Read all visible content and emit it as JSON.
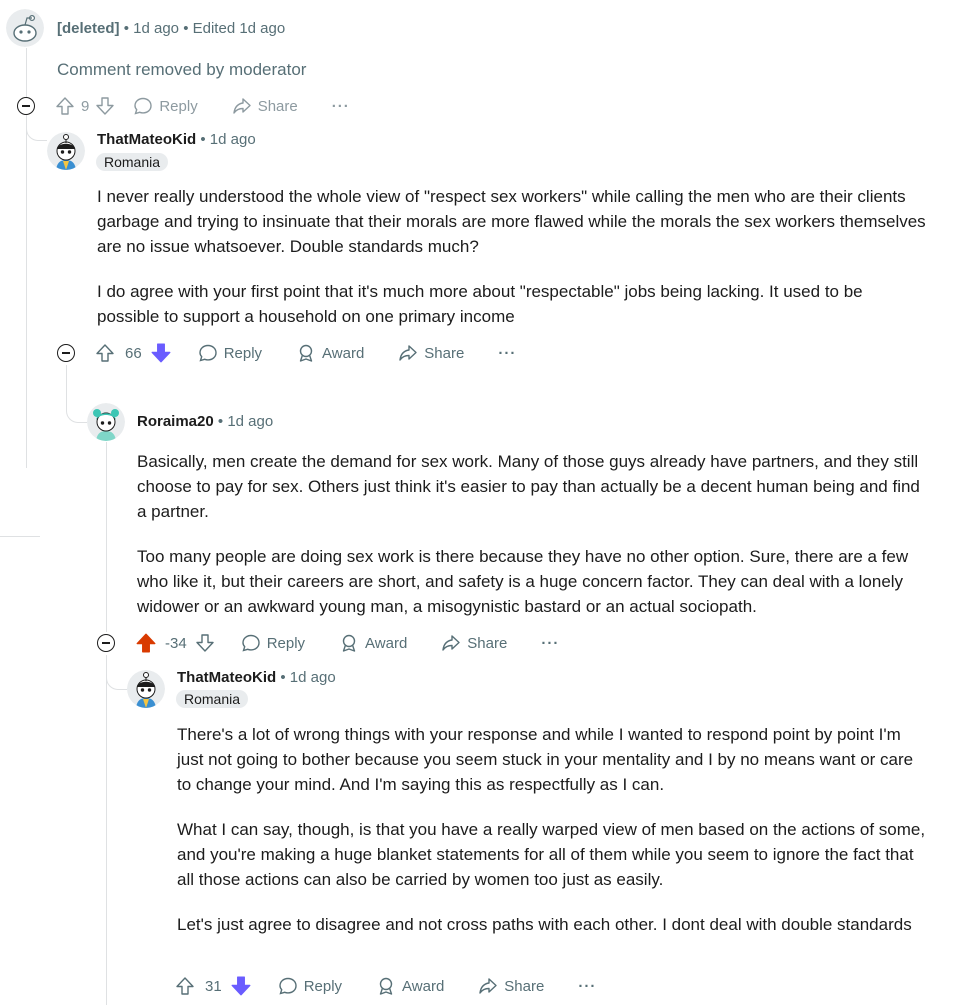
{
  "comments": [
    {
      "author": "[deleted]",
      "time": "1d ago",
      "edited": "Edited 1d ago",
      "body_removed": "Comment removed by moderator",
      "score": "9",
      "reply_label": "Reply",
      "share_label": "Share",
      "more_label": "···"
    },
    {
      "author": "ThatMateoKid",
      "time": "1d ago",
      "flair": "Romania",
      "paragraphs": [
        "I never really understood the whole view of \"respect sex workers\" while calling the men who are their clients garbage and trying to insinuate that their morals are more flawed while the morals the sex workers themselves are no issue whatsoever. Double standards much?",
        "I do agree with your first point that it's much more about \"respectable\" jobs being lacking. It used to be possible to support a household on one primary income"
      ],
      "score": "66",
      "vote_state": "downvoted",
      "reply_label": "Reply",
      "award_label": "Award",
      "share_label": "Share",
      "more_label": "···"
    },
    {
      "author": "Roraima20",
      "time": "1d ago",
      "paragraphs": [
        "Basically, men create the demand for sex work. Many of those guys already have partners, and they still choose to pay for sex. Others just think it's easier to pay than actually be a decent human being and find a partner.",
        "Too many people are doing sex work is there because they have no other option. Sure, there are a few who like it, but their careers are short, and safety is a huge concern factor. They can deal with a lonely widower or an awkward young man, a misogynistic bastard or an actual sociopath."
      ],
      "score": "-34",
      "vote_state": "upvoted",
      "reply_label": "Reply",
      "award_label": "Award",
      "share_label": "Share",
      "more_label": "···"
    },
    {
      "author": "ThatMateoKid",
      "time": "1d ago",
      "flair": "Romania",
      "paragraphs": [
        "There's a lot of wrong things with your response and while I wanted to respond point by point I'm just not going to bother because you seem stuck in your mentality and I by no means want or care to change your mind. And I'm saying this as respectfully as I can.",
        "What I can say, though, is that you have a really warped view of men based on the actions of some, and you're making a huge blanket statements for all of them while you seem to ignore the fact that all those actions can also be carried by women too just as easily.",
        "Let's just agree to disagree and not cross paths with each other. I dont deal with double standards"
      ],
      "score": "31",
      "vote_state": "downvoted",
      "reply_label": "Reply",
      "award_label": "Award",
      "share_label": "Share",
      "more_label": "···"
    }
  ],
  "separator": "•",
  "colors": {
    "upvote": "#d93a00",
    "downvote": "#6a5cff",
    "meta": "#576f76",
    "thread_line": "#dfe1e3"
  }
}
